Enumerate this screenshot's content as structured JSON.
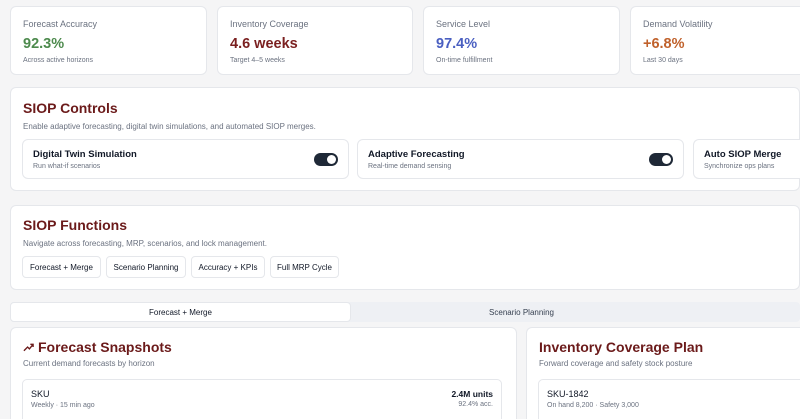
{
  "kpis": [
    {
      "label": "Forecast Accuracy",
      "value": "92.3%",
      "sub": "Across active horizons",
      "color": "#4d8a4d"
    },
    {
      "label": "Inventory Coverage",
      "value": "4.6 weeks",
      "sub": "Target 4–5 weeks",
      "color": "#7a1f1f"
    },
    {
      "label": "Service Level",
      "value": "97.4%",
      "sub": "On-time fulfillment",
      "color": "#4a5fc1"
    },
    {
      "label": "Demand Volatility",
      "value": "+6.8%",
      "sub": "Last 30 days",
      "color": "#c0612b"
    }
  ],
  "controls": {
    "title": "SIOP Controls",
    "subtitle": "Enable adaptive forecasting, digital twin simulations, and automated SIOP merges.",
    "toggles": [
      {
        "title": "Digital Twin Simulation",
        "sub": "Run what-if scenarios",
        "on": true
      },
      {
        "title": "Adaptive Forecasting",
        "sub": "Real-time demand sensing",
        "on": true
      },
      {
        "title": "Auto SIOP Merge",
        "sub": "Synchronize ops plans"
      }
    ]
  },
  "functions": {
    "title": "SIOP Functions",
    "subtitle": "Navigate across forecasting, MRP, scenarios, and lock management.",
    "buttons": [
      "Forecast + Merge",
      "Scenario Planning",
      "Accuracy + KPIs",
      "Full MRP Cycle"
    ]
  },
  "tabs": [
    "Forecast + Merge",
    "Scenario Planning"
  ],
  "snapshots": {
    "title": "Forecast Snapshots",
    "subtitle": "Current demand forecasts by horizon",
    "row": {
      "name": "SKU",
      "meta": "Weekly · 15 min ago",
      "units": "2.4M units",
      "acc": "92.4% acc."
    }
  },
  "coverage": {
    "title": "Inventory Coverage Plan",
    "subtitle": "Forward coverage and safety stock posture",
    "row": {
      "name": "SKU-1842",
      "meta": "On hand 8,200 · Safety 3,000"
    }
  }
}
